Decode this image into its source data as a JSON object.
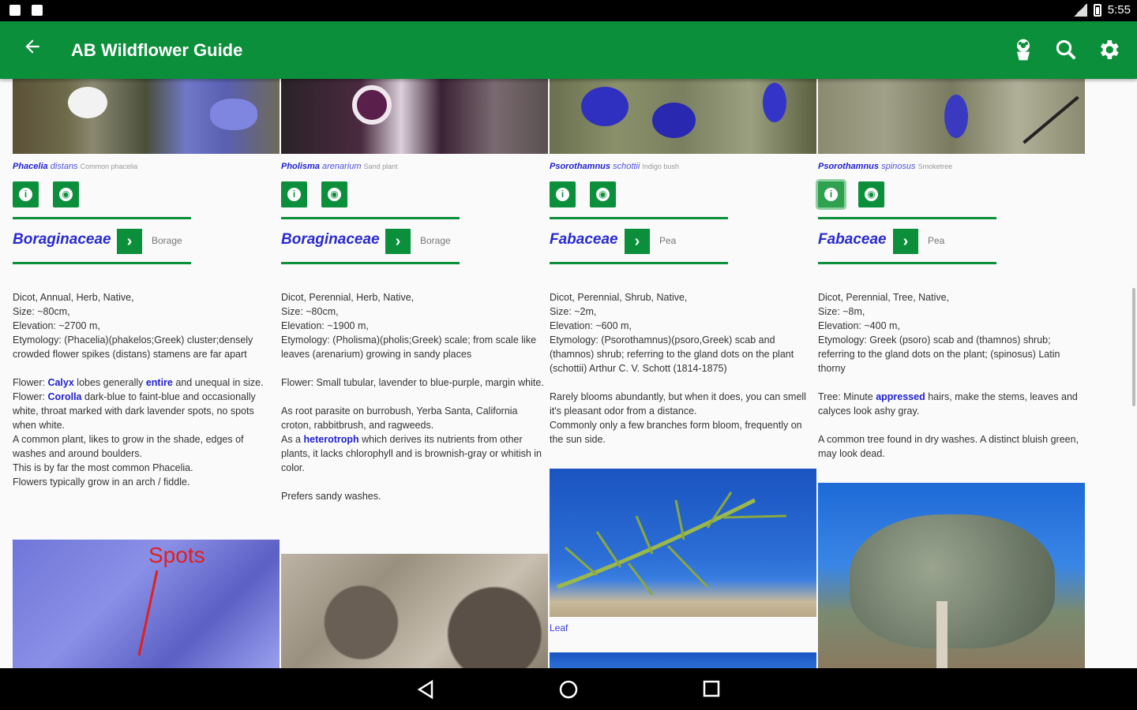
{
  "status_bar": {
    "time": "5:55"
  },
  "app_bar": {
    "title": "AB Wildflower Guide"
  },
  "columns": [
    {
      "genus": "Phacelia",
      "species": "distans",
      "common": "Common phacelia",
      "family": "Boraginaceae",
      "family_common": "Borage",
      "paras": [
        [
          "Dicot, Annual, Herb, Native,",
          "Size: ~80cm,",
          "Elevation: ~2700 m,",
          "Etymology: (Phacelia)(phakelos;Greek) cluster;densely crowded flower spikes (distans) stamens are far apart"
        ],
        [
          "Flower: ",
          "Calyx",
          " lobes generally ",
          "entire",
          " and unequal in size.",
          "Flower: ",
          "Corolla",
          " dark-blue to faint-blue and occasionally white, throat marked with dark lavender spots, no spots when white.",
          "A common plant, likes to grow in the shade, edges of washes and around boulders.",
          "This is by far the most common Phacelia.",
          "Flowers typically grow in an arch / fiddle."
        ]
      ],
      "img_label": "Spots"
    },
    {
      "genus": "Pholisma",
      "species": "arenarium",
      "common": "Sand plant",
      "family": "Boraginaceae",
      "family_common": "Borage",
      "paras": [
        [
          "Dicot, Perennial, Herb, Native,",
          "Size: ~80cm,",
          "Elevation: ~1900 m,",
          "Etymology: (Pholisma)(pholis;Greek) scale; from scale like leaves (arenarium) growing in sandy places"
        ],
        [
          "Flower: Small tubular, lavender to blue-purple, margin white."
        ],
        [
          "As root parasite on burrobush, Yerba Santa, California croton, rabbitbrush, and ragweeds.",
          "As a ",
          "heterotroph",
          " which derives its nutrients from other plants, it lacks chlorophyll and is brownish-gray or whitish in color."
        ],
        [
          "Prefers sandy washes."
        ]
      ]
    },
    {
      "genus": "Psorothamnus",
      "species": "schottii",
      "common": "Indigo bush",
      "family": "Fabaceae",
      "family_common": "Pea",
      "paras": [
        [
          "Dicot, Perennial, Shrub, Native,",
          "Size: ~2m,",
          "Elevation: ~600 m,",
          "Etymology: (Psorothamnus)(psoro,Greek) scab and (thamnos) shrub; referring to the gland dots on the plant (schottii) Arthur C. V. Schott (1814-1875)"
        ],
        [
          "Rarely blooms abundantly, but when it does, you can smell it's pleasant odor from a distance.",
          "Commonly only a few branches form bloom, frequently on the sun side."
        ]
      ],
      "img_caption": "Leaf"
    },
    {
      "genus": "Psorothamnus",
      "species": "spinosus",
      "common": "Smoketree",
      "family": "Fabaceae",
      "family_common": "Pea",
      "paras": [
        [
          "Dicot, Perennial, Tree, Native,",
          "Size: ~8m,",
          "Elevation: ~400 m,",
          "Etymology: Greek (psoro) scab and (thamnos) shrub; referring to the gland dots on the plant; (spinosus) Latin thorny"
        ],
        [
          "Tree: Minute ",
          "appressed",
          " hairs, make the stems, leaves and calyces look ashy gray."
        ],
        [
          "A common tree found in dry washes. A distinct bluish green, may look dead."
        ]
      ]
    }
  ]
}
